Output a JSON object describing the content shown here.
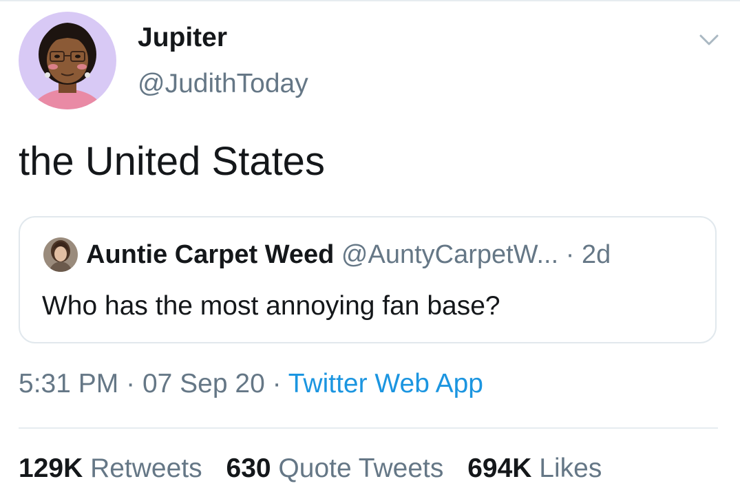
{
  "tweet": {
    "display_name": "Jupiter",
    "handle": "@JudithToday",
    "text": "the United States",
    "avatar_icon": "cartoon-avatar-icon",
    "menu_icon": "chevron-down-icon"
  },
  "quote": {
    "display_name": "Auntie Carpet Weed",
    "handle": "@AuntyCarpetW...",
    "separator": "·",
    "time": "2d",
    "text": "Who has the most annoying fan base?",
    "avatar_icon": "photo-avatar-icon"
  },
  "meta": {
    "time": "5:31 PM",
    "sep1": "·",
    "date": "07 Sep 20",
    "sep2": "·",
    "source": "Twitter Web App"
  },
  "stats": {
    "retweets_count": "129K",
    "retweets_label": "Retweets",
    "quotes_count": "630",
    "quotes_label": "Quote Tweets",
    "likes_count": "694K",
    "likes_label": "Likes"
  },
  "colors": {
    "text": "#14171a",
    "secondary": "#657786",
    "link": "#1b95e0",
    "border": "#e1e8ed",
    "avatar_bg": "#d8c9f5"
  }
}
